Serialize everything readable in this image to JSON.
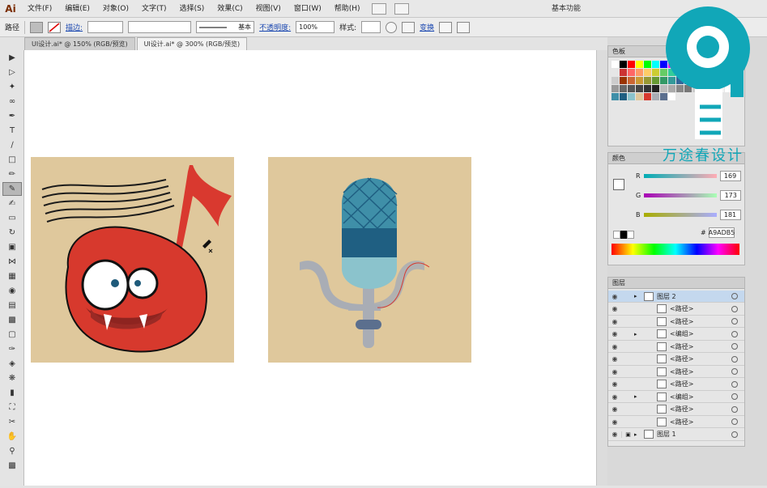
{
  "app": {
    "logo": "Ai",
    "workspace": "基本功能"
  },
  "menu": [
    "文件(F)",
    "编辑(E)",
    "对象(O)",
    "文字(T)",
    "选择(S)",
    "效果(C)",
    "视图(V)",
    "窗口(W)",
    "帮助(H)"
  ],
  "control": {
    "object_type": "路径",
    "stroke_label": "描边:",
    "stroke_style": "基本",
    "opacity_label": "不透明度:",
    "opacity_value": "100%",
    "style_label": "样式:",
    "transform_label": "变换"
  },
  "tabs": [
    {
      "label": "UI设计.ai* @ 150% (RGB/预览)",
      "active": false
    },
    {
      "label": "UI设计.ai* @ 300% (RGB/预览)",
      "active": true
    }
  ],
  "panels": {
    "swatches_title": "色板",
    "color_title": "颜色",
    "color": {
      "r_label": "R",
      "r": "169",
      "g_label": "G",
      "g": "173",
      "b_label": "B",
      "b": "181",
      "hex_label": "#",
      "hex": "A9ADB5"
    },
    "layers_title": "图层",
    "layers": [
      {
        "name": "图层 2",
        "kind": "layer",
        "selected": true
      },
      {
        "name": "<路径>",
        "kind": "path"
      },
      {
        "name": "<路径>",
        "kind": "path"
      },
      {
        "name": "<编组>",
        "kind": "group"
      },
      {
        "name": "<路径>",
        "kind": "path"
      },
      {
        "name": "<路径>",
        "kind": "path"
      },
      {
        "name": "<路径>",
        "kind": "path"
      },
      {
        "name": "<路径>",
        "kind": "path"
      },
      {
        "name": "<编组>",
        "kind": "group"
      },
      {
        "name": "<路径>",
        "kind": "path"
      },
      {
        "name": "<路径>",
        "kind": "path"
      },
      {
        "name": "图层 1",
        "kind": "layer"
      }
    ]
  },
  "watermark": {
    "text": "万途春设计"
  },
  "colors": {
    "artboard_bg": "#dfc89c",
    "monster_red": "#d7392d",
    "note_red": "#d9392f",
    "mic_head": "#3f8fa8",
    "mic_band": "#1f5f82",
    "mic_body": "#8bc3cc",
    "stand_gray": "#a9adb5",
    "watermark": "#11a7b8"
  }
}
